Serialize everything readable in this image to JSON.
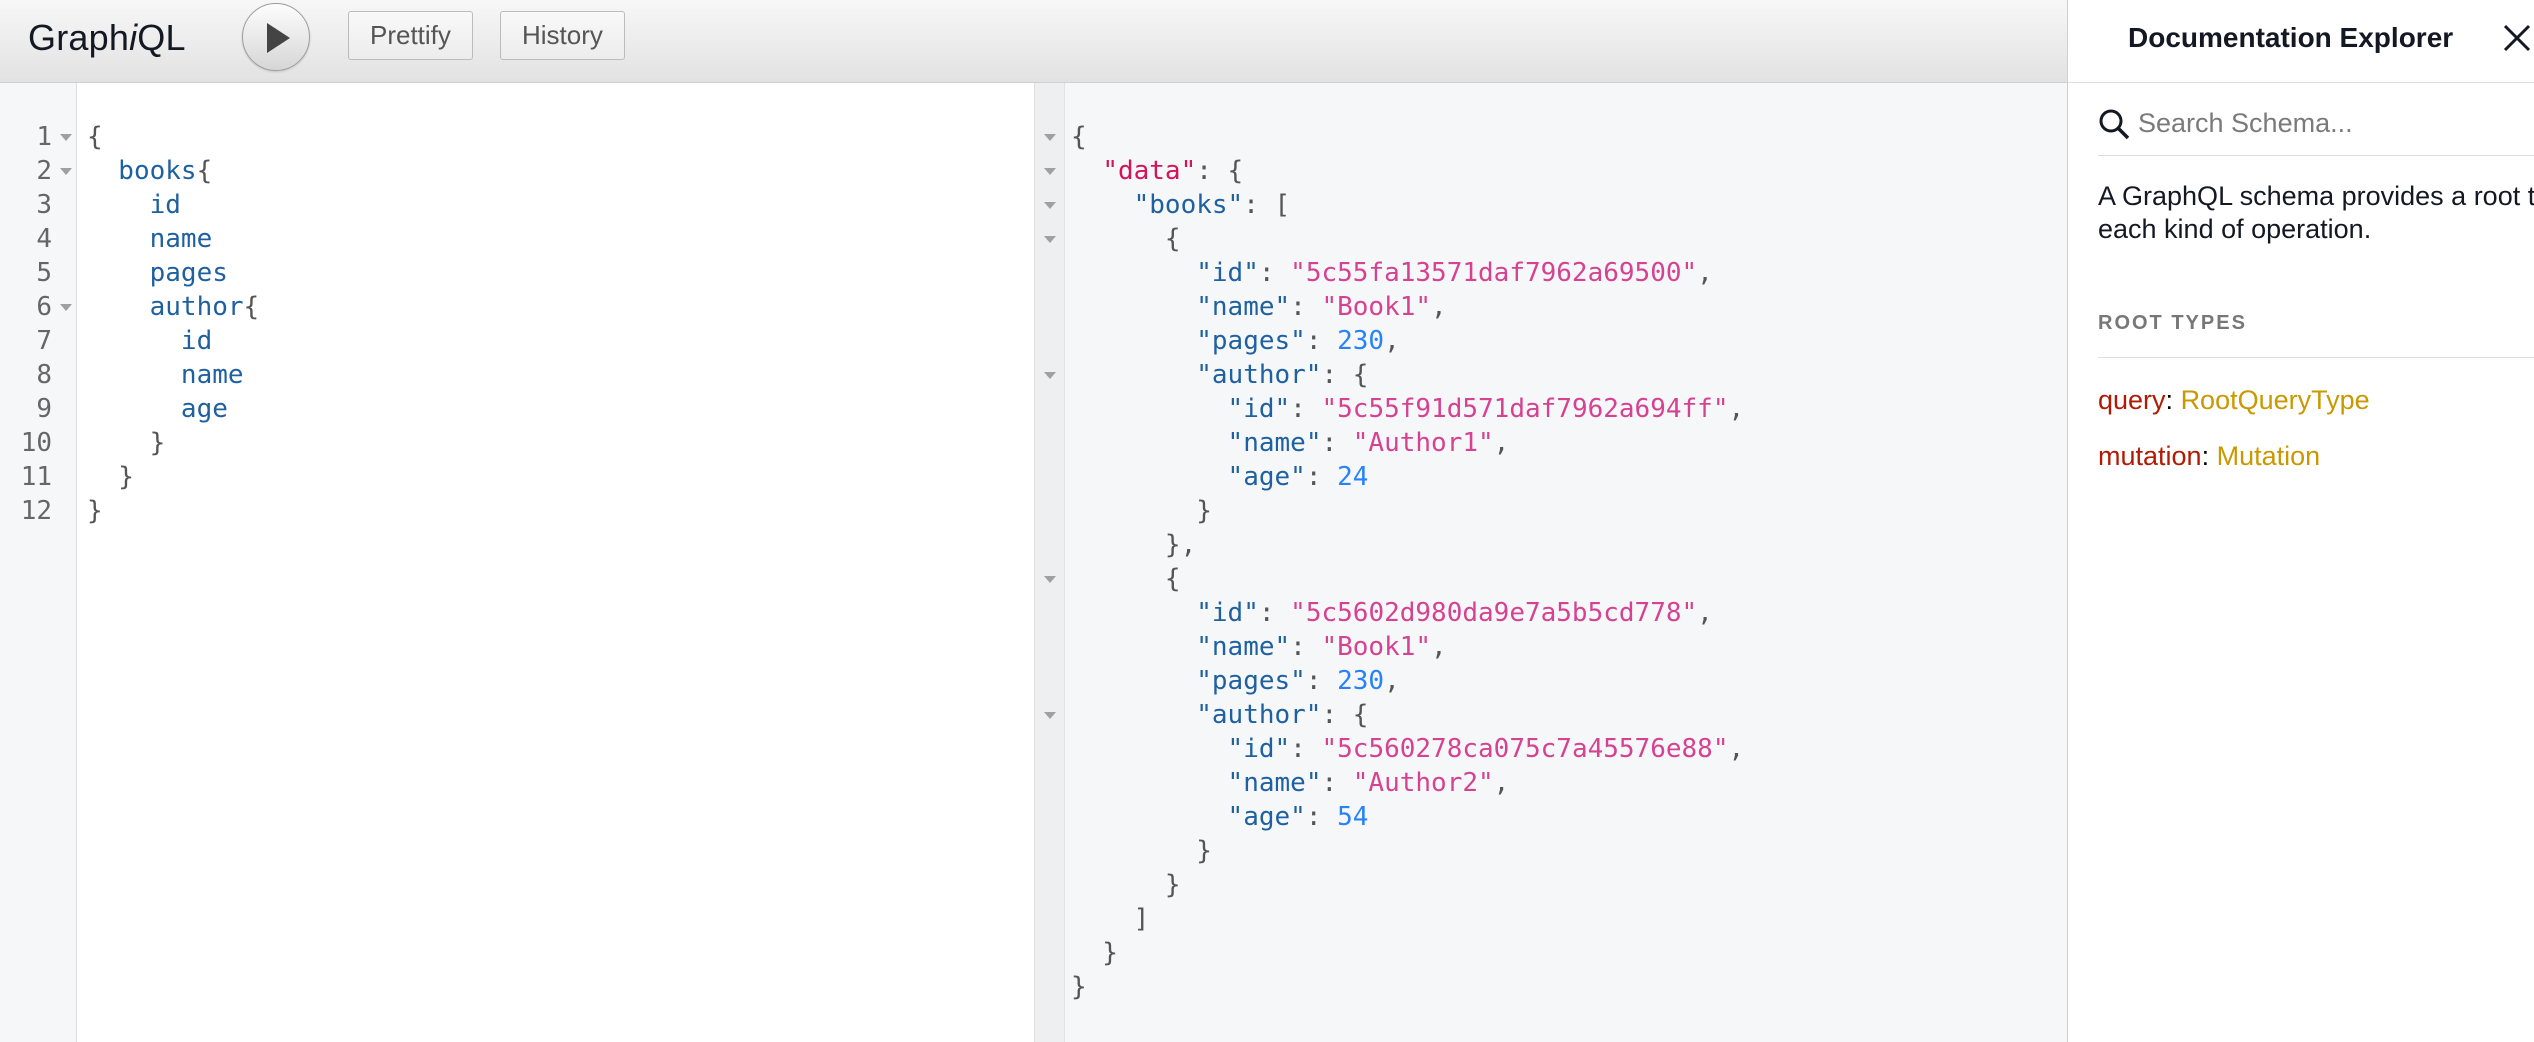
{
  "app": {
    "logo_prefix": "Graph",
    "logo_italic": "i",
    "logo_suffix": "QL"
  },
  "toolbar": {
    "run_icon": "play-icon",
    "prettify_label": "Prettify",
    "history_label": "History"
  },
  "query": {
    "line_numbers": [
      "1",
      "2",
      "3",
      "4",
      "5",
      "6",
      "7",
      "8",
      "9",
      "10",
      "11",
      "12"
    ],
    "lines": [
      [
        {
          "t": "{",
          "c": "punct"
        }
      ],
      [
        {
          "t": "  books",
          "c": "field"
        },
        {
          "t": "{",
          "c": "punct"
        }
      ],
      [
        {
          "t": "    id",
          "c": "field"
        }
      ],
      [
        {
          "t": "    name",
          "c": "field"
        }
      ],
      [
        {
          "t": "    pages",
          "c": "field"
        }
      ],
      [
        {
          "t": "    author",
          "c": "field"
        },
        {
          "t": "{",
          "c": "punct"
        }
      ],
      [
        {
          "t": "      id",
          "c": "field"
        }
      ],
      [
        {
          "t": "      name",
          "c": "field"
        }
      ],
      [
        {
          "t": "      age",
          "c": "field"
        }
      ],
      [
        {
          "t": "    }",
          "c": "punct"
        }
      ],
      [
        {
          "t": "  }",
          "c": "punct"
        }
      ],
      [
        {
          "t": "}",
          "c": "punct"
        }
      ]
    ]
  },
  "result": {
    "lines": [
      [
        {
          "t": "{",
          "c": "punct"
        }
      ],
      [
        {
          "t": "  ",
          "c": "punct"
        },
        {
          "t": "\"data\"",
          "c": "keydata"
        },
        {
          "t": ": {",
          "c": "punct"
        }
      ],
      [
        {
          "t": "    ",
          "c": "punct"
        },
        {
          "t": "\"books\"",
          "c": "key"
        },
        {
          "t": ": [",
          "c": "punct"
        }
      ],
      [
        {
          "t": "      {",
          "c": "punct"
        }
      ],
      [
        {
          "t": "        ",
          "c": "punct"
        },
        {
          "t": "\"id\"",
          "c": "key"
        },
        {
          "t": ": ",
          "c": "punct"
        },
        {
          "t": "\"5c55fa13571daf7962a69500\"",
          "c": "str"
        },
        {
          "t": ",",
          "c": "punct"
        }
      ],
      [
        {
          "t": "        ",
          "c": "punct"
        },
        {
          "t": "\"name\"",
          "c": "key"
        },
        {
          "t": ": ",
          "c": "punct"
        },
        {
          "t": "\"Book1\"",
          "c": "str"
        },
        {
          "t": ",",
          "c": "punct"
        }
      ],
      [
        {
          "t": "        ",
          "c": "punct"
        },
        {
          "t": "\"pages\"",
          "c": "key"
        },
        {
          "t": ": ",
          "c": "punct"
        },
        {
          "t": "230",
          "c": "num"
        },
        {
          "t": ",",
          "c": "punct"
        }
      ],
      [
        {
          "t": "        ",
          "c": "punct"
        },
        {
          "t": "\"author\"",
          "c": "key"
        },
        {
          "t": ": {",
          "c": "punct"
        }
      ],
      [
        {
          "t": "          ",
          "c": "punct"
        },
        {
          "t": "\"id\"",
          "c": "key"
        },
        {
          "t": ": ",
          "c": "punct"
        },
        {
          "t": "\"5c55f91d571daf7962a694ff\"",
          "c": "str"
        },
        {
          "t": ",",
          "c": "punct"
        }
      ],
      [
        {
          "t": "          ",
          "c": "punct"
        },
        {
          "t": "\"name\"",
          "c": "key"
        },
        {
          "t": ": ",
          "c": "punct"
        },
        {
          "t": "\"Author1\"",
          "c": "str"
        },
        {
          "t": ",",
          "c": "punct"
        }
      ],
      [
        {
          "t": "          ",
          "c": "punct"
        },
        {
          "t": "\"age\"",
          "c": "key"
        },
        {
          "t": ": ",
          "c": "punct"
        },
        {
          "t": "24",
          "c": "num"
        }
      ],
      [
        {
          "t": "        }",
          "c": "punct"
        }
      ],
      [
        {
          "t": "      },",
          "c": "punct"
        }
      ],
      [
        {
          "t": "      {",
          "c": "punct"
        }
      ],
      [
        {
          "t": "        ",
          "c": "punct"
        },
        {
          "t": "\"id\"",
          "c": "key"
        },
        {
          "t": ": ",
          "c": "punct"
        },
        {
          "t": "\"5c5602d980da9e7a5b5cd778\"",
          "c": "str"
        },
        {
          "t": ",",
          "c": "punct"
        }
      ],
      [
        {
          "t": "        ",
          "c": "punct"
        },
        {
          "t": "\"name\"",
          "c": "key"
        },
        {
          "t": ": ",
          "c": "punct"
        },
        {
          "t": "\"Book1\"",
          "c": "str"
        },
        {
          "t": ",",
          "c": "punct"
        }
      ],
      [
        {
          "t": "        ",
          "c": "punct"
        },
        {
          "t": "\"pages\"",
          "c": "key"
        },
        {
          "t": ": ",
          "c": "punct"
        },
        {
          "t": "230",
          "c": "num"
        },
        {
          "t": ",",
          "c": "punct"
        }
      ],
      [
        {
          "t": "        ",
          "c": "punct"
        },
        {
          "t": "\"author\"",
          "c": "key"
        },
        {
          "t": ": {",
          "c": "punct"
        }
      ],
      [
        {
          "t": "          ",
          "c": "punct"
        },
        {
          "t": "\"id\"",
          "c": "key"
        },
        {
          "t": ": ",
          "c": "punct"
        },
        {
          "t": "\"5c560278ca075c7a45576e88\"",
          "c": "str"
        },
        {
          "t": ",",
          "c": "punct"
        }
      ],
      [
        {
          "t": "          ",
          "c": "punct"
        },
        {
          "t": "\"name\"",
          "c": "key"
        },
        {
          "t": ": ",
          "c": "punct"
        },
        {
          "t": "\"Author2\"",
          "c": "str"
        },
        {
          "t": ",",
          "c": "punct"
        }
      ],
      [
        {
          "t": "          ",
          "c": "punct"
        },
        {
          "t": "\"age\"",
          "c": "key"
        },
        {
          "t": ": ",
          "c": "punct"
        },
        {
          "t": "54",
          "c": "num"
        }
      ],
      [
        {
          "t": "        }",
          "c": "punct"
        }
      ],
      [
        {
          "t": "      }",
          "c": "punct"
        }
      ],
      [
        {
          "t": "    ]",
          "c": "punct"
        }
      ],
      [
        {
          "t": "  }",
          "c": "punct"
        }
      ],
      [
        {
          "t": "}",
          "c": "punct"
        }
      ]
    ]
  },
  "docs": {
    "title": "Documentation Explorer",
    "close_icon": "close-icon",
    "search_icon": "search-icon",
    "search_placeholder": "Search Schema...",
    "description_line1": "A GraphQL schema provides a root type for",
    "description_line2": "each kind of operation.",
    "section_title": "ROOT TYPES",
    "root_types": [
      {
        "name": "query",
        "type": "RootQueryType"
      },
      {
        "name": "mutation",
        "type": "Mutation"
      }
    ]
  },
  "colors": {
    "field": "#1f61a0",
    "json_key_data": "#d5135a",
    "json_string": "#d64292",
    "json_number": "#2882f9",
    "doc_field_name": "#b11a04",
    "doc_type_name": "#ca9800"
  }
}
